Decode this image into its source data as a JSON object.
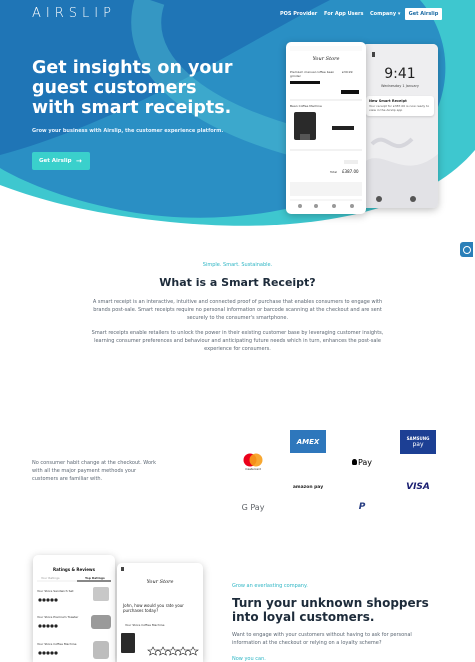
{
  "brand": {
    "logo": "AIRSLIP"
  },
  "nav": {
    "items": [
      "POS Provider",
      "For App Users",
      "Company"
    ],
    "company_caret": "▾",
    "cta": "Get Airslip"
  },
  "hero": {
    "title": "Get insights on your guest customers with smart receipts.",
    "subtitle": "Grow your business with Airslip, the customer experience platform.",
    "cta": "Get Airslip",
    "cta_arrow": "→"
  },
  "phone_receipt": {
    "store": "Your Store",
    "product1": "Premium manual coffee bean grinder",
    "price1": "£39.99",
    "product2": "Bean Coffee Machine",
    "total_label": "Total",
    "total": "£387.00"
  },
  "phone_lock": {
    "time": "9:41",
    "date": "Wednesday 1 January",
    "notification_title": "New Smart Receipt",
    "notification_body": "Your receipt for £387.00 is now ready to view in the Airslip app"
  },
  "smart_receipt": {
    "eyebrow": "Simple. Smart. Sustainable.",
    "title": "What is a Smart Receipt?",
    "para1": "A smart receipt is an interactive, intuitive and connected proof of purchase that enables consumers to engage with brands post-sale. Smart receipts require no personal information or barcode scanning at the checkout and are sent securely to the consumer's smartphone.",
    "para2": "Smart receipts enable retailers to unlock the power in their existing customer base by leveraging customer insights, learning consumer preferences and behaviour and anticipating future needs which in turn, enhances the post-sale experience for consumers."
  },
  "payments": {
    "text": "No consumer habit change at the checkout. Work with all the major payment methods your customers are familiar with.",
    "logos": {
      "mastercard": "mastercard",
      "amex": "AMEX",
      "samsung": "SAMSUNG",
      "samsung_pay": "pay",
      "apple_pay": "Pay",
      "amazon_pay": "amazon pay",
      "visa": "VISA",
      "google_pay": "G Pay",
      "paypal": "P"
    }
  },
  "phone_ratings": {
    "title": "Ratings & Reviews",
    "tab1": "Your Ratings",
    "tab2": "Top Ratings",
    "items": [
      "Your Store Sandwich Set",
      "Your Store Premium Toaster",
      "Your Store Coffee Machine"
    ]
  },
  "phone_review": {
    "store": "Your Store",
    "question": "John, how would you rate your purchases today?",
    "item": "Your Store Coffee Machine"
  },
  "loyalty": {
    "eyebrow": "Grow an everlasting company.",
    "title": "Turn your unknown shoppers into loyal customers.",
    "para": "Want to engage with your customers without having to ask for personal information at the checkout or relying on a loyalty scheme?",
    "link": "Now you can."
  },
  "colors": {
    "hero_dark": "#1e72b5",
    "hero_teal": "#3ec7cf",
    "accent": "#2cb5c4",
    "amex": "#2e77bc",
    "samsung_pay": "#1c3f94",
    "visa": "#1a1f71",
    "paypal": "#253b80"
  }
}
